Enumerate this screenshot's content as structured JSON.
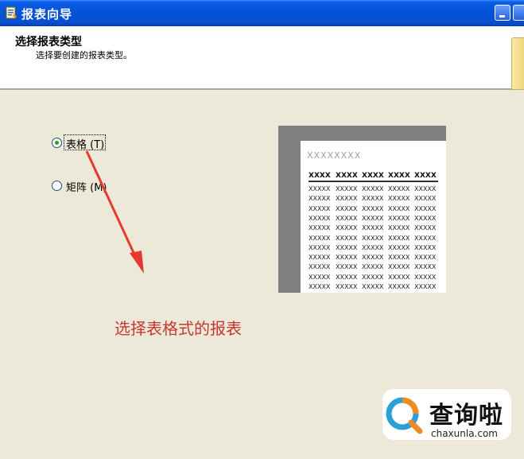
{
  "window": {
    "title": "报表向导"
  },
  "header": {
    "title": "选择报表类型",
    "subtitle": "选择要创建的报表类型。"
  },
  "options": [
    {
      "label": "表格 (T)",
      "selected": true
    },
    {
      "label": "矩阵 (M)",
      "selected": false
    }
  ],
  "preview": {
    "title": "XXXXXXXX",
    "header_cell": "XXXX",
    "cell": "XXXXX",
    "columns": 5,
    "rows": 11
  },
  "annotation": "选择表格式的报表",
  "watermark": {
    "name": "查询啦",
    "url": "chaxunla.com"
  },
  "colors": {
    "titlebar": "#0453d9",
    "dialog_bg": "#ece9d8",
    "annotation": "#c8372f",
    "radio_dot": "#21a121"
  },
  "icons": [
    "wizard-icon",
    "minimize-icon",
    "maximize-icon",
    "folder-decoration-icon",
    "arrow-annotation-icon",
    "search-logo-icon"
  ]
}
